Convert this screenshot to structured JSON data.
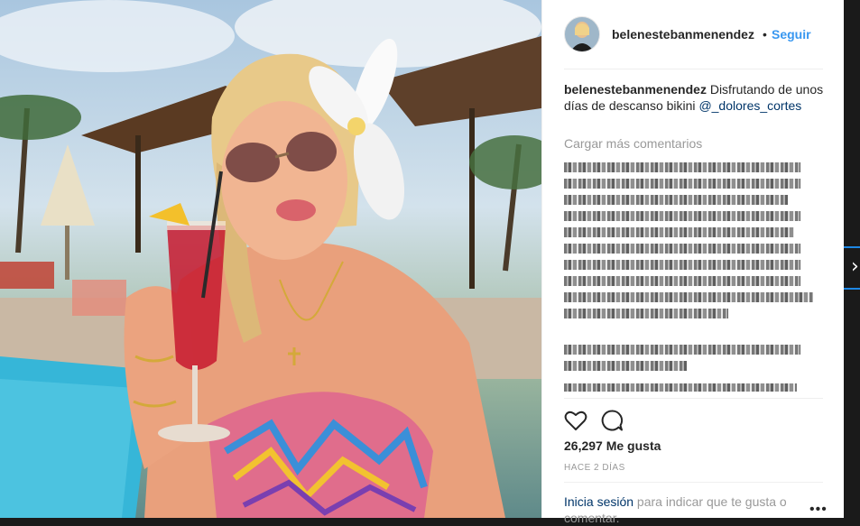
{
  "post": {
    "username": "belenestebanmenendez",
    "separator": "•",
    "follow_label": "Seguir",
    "caption_user": "belenestebanmenendez",
    "caption_text": " Disfrutando de unos días de descanso bikini ",
    "caption_mention": "@_dolores_cortes",
    "load_more": "Cargar más comentarios",
    "likes": "26,297 Me gusta",
    "time": "Hace 2 días",
    "login_link": "Inicia sesión",
    "login_text": " para indicar que te gusta o comentar.",
    "more_dots": "•••"
  },
  "icons": {
    "like": "heart-icon",
    "comment": "comment-icon",
    "next": "chevron-right-icon"
  },
  "colors": {
    "accent": "#3897f0",
    "link": "#003569",
    "muted": "#999999",
    "text": "#262626",
    "nav_highlight": "#1e88e5"
  }
}
